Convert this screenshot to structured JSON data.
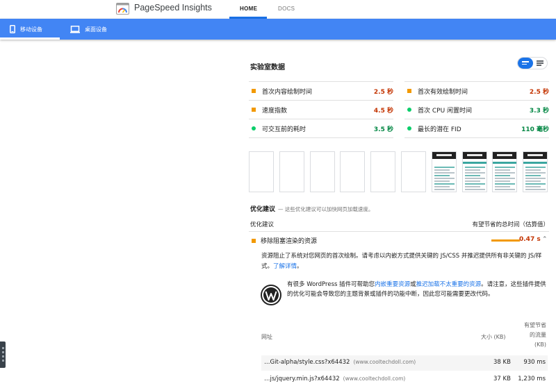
{
  "header": {
    "brand": "PageSpeed Insights",
    "tabs": [
      {
        "label": "HOME",
        "active": true
      },
      {
        "label": "DOCS",
        "active": false
      }
    ]
  },
  "device_tabs": [
    {
      "label": "移动设备",
      "icon": "mobile-phone-icon",
      "active": true
    },
    {
      "label": "桌面设备",
      "icon": "desktop-monitor-icon",
      "active": false
    }
  ],
  "lab": {
    "title": "实验室数据",
    "metrics": [
      {
        "name": "首次内容绘制时间",
        "value": "2.5 秒",
        "status": "average",
        "icon": "orange-square-icon"
      },
      {
        "name": "首次有效绘制时间",
        "value": "2.5 秒",
        "status": "average",
        "icon": "orange-square-icon"
      },
      {
        "name": "速度指数",
        "value": "4.5 秒",
        "status": "average",
        "icon": "orange-square-icon"
      },
      {
        "name": "首次 CPU 闲置时间",
        "value": "3.3 秒",
        "status": "pass",
        "icon": "green-circle-icon"
      },
      {
        "name": "可交互前的耗时",
        "value": "3.5 秒",
        "status": "pass",
        "icon": "green-circle-icon"
      },
      {
        "name": "最长的潜在 FID",
        "value": "110 毫秒",
        "status": "pass",
        "icon": "green-circle-icon"
      }
    ]
  },
  "filmstrip": {
    "frame_count": 10,
    "loaded_from": 6
  },
  "opportunities": {
    "heading": "优化建议",
    "subheading": "— 这些优化建议可以加快网页加载速度。",
    "col_left": "优化建议",
    "col_right": "有望节省的总时间（估算值）",
    "audit": {
      "title": "移除阻塞渲染的资源",
      "savings": "0.47 s",
      "savings_fraction": 0.47,
      "description": "资源阻止了系统对您网页的首次绘制。请考虑以内嵌方式提供关键的 JS/CSS 并推迟提供所有非关键的 JS/样式。",
      "learn_more": "了解详情",
      "wp_text_1": "有很多 WordPress 插件可帮助您",
      "wp_link_1": "内嵌重要资源",
      "wp_text_2": "或",
      "wp_link_2": "推迟加载不太重要的资源",
      "wp_text_3": "。请注意，这些插件提供的优化可能会导致您的主题背景或插件的功能中断，因此您可能需要更改代码。",
      "table": {
        "col_url": "网址",
        "col_size": "大小 (KB)",
        "col_savings": "有望节省\n的流量\n(KB)",
        "col_savings_lines": [
          "有望节省",
          "的流量",
          "(KB)"
        ],
        "rows": [
          {
            "url": "…Git-alpha/style.css?x64432",
            "domain": "(www.cooltechdoll.com)",
            "size": "38 KB",
            "savings": "930 ms"
          },
          {
            "url": "…js/jquery.min.js?x64432",
            "domain": "(www.cooltechdoll.com)",
            "size": "37 KB",
            "savings": "1,230 ms"
          }
        ]
      }
    }
  },
  "colors": {
    "accent": "#4285f4",
    "average": "#f29900",
    "average_text": "#c33300",
    "pass": "#0cce6b",
    "pass_text": "#018642"
  }
}
